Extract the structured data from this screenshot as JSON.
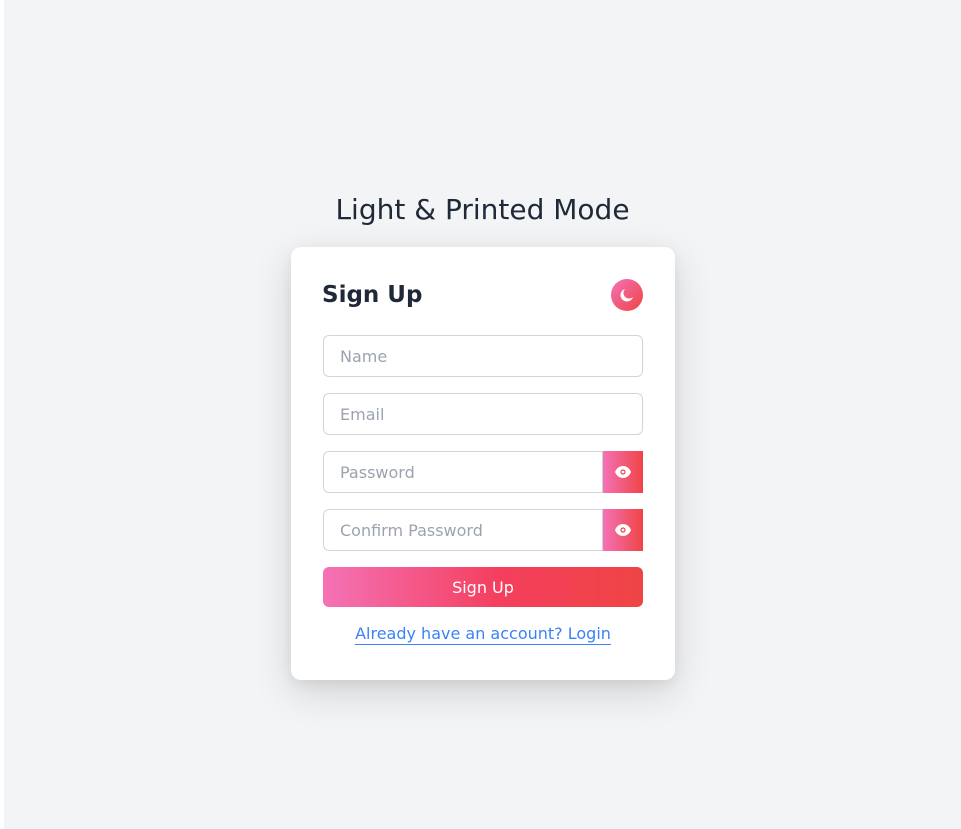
{
  "page": {
    "title": "Light & Printed Mode"
  },
  "form": {
    "title": "Sign Up",
    "theme_toggle_icon": "moon-icon",
    "fields": {
      "name": {
        "placeholder": "Name",
        "value": ""
      },
      "email": {
        "placeholder": "Email",
        "value": ""
      },
      "password": {
        "placeholder": "Password",
        "value": "",
        "toggle_icon": "eye-icon"
      },
      "confirm_password": {
        "placeholder": "Confirm Password",
        "value": "",
        "toggle_icon": "eye-icon"
      }
    },
    "submit_label": "Sign Up",
    "login_link_text": "Already have an account? Login"
  },
  "colors": {
    "accent_start": "#f472b6",
    "accent_end": "#ef4444",
    "link": "#3b82f6",
    "background": "#f3f4f6",
    "card": "#ffffff"
  }
}
